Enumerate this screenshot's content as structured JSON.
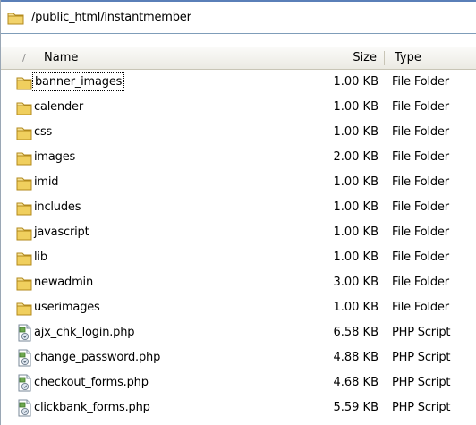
{
  "path": "/public_html/instantmember",
  "columns": {
    "sort_arrow": "/",
    "name": "Name",
    "size": "Size",
    "type": "Type"
  },
  "files": [
    {
      "name": "banner_images",
      "size": "1.00 KB",
      "type": "File Folder",
      "icon": "folder-icon"
    },
    {
      "name": "calender",
      "size": "1.00 KB",
      "type": "File Folder",
      "icon": "folder-icon"
    },
    {
      "name": "css",
      "size": "1.00 KB",
      "type": "File Folder",
      "icon": "folder-icon"
    },
    {
      "name": "images",
      "size": "2.00 KB",
      "type": "File Folder",
      "icon": "folder-icon"
    },
    {
      "name": "imid",
      "size": "1.00 KB",
      "type": "File Folder",
      "icon": "folder-icon"
    },
    {
      "name": "includes",
      "size": "1.00 KB",
      "type": "File Folder",
      "icon": "folder-icon"
    },
    {
      "name": "javascript",
      "size": "1.00 KB",
      "type": "File Folder",
      "icon": "folder-icon"
    },
    {
      "name": "lib",
      "size": "1.00 KB",
      "type": "File Folder",
      "icon": "folder-icon"
    },
    {
      "name": "newadmin",
      "size": "3.00 KB",
      "type": "File Folder",
      "icon": "folder-icon"
    },
    {
      "name": "userimages",
      "size": "1.00 KB",
      "type": "File Folder",
      "icon": "folder-icon"
    },
    {
      "name": "ajx_chk_login.php",
      "size": "6.58 KB",
      "type": "PHP Script",
      "icon": "php-file-icon"
    },
    {
      "name": "change_password.php",
      "size": "4.88 KB",
      "type": "PHP Script",
      "icon": "php-file-icon"
    },
    {
      "name": "checkout_forms.php",
      "size": "4.68 KB",
      "type": "PHP Script",
      "icon": "php-file-icon"
    },
    {
      "name": "clickbank_forms.php",
      "size": "5.59 KB",
      "type": "PHP Script",
      "icon": "php-file-icon"
    }
  ]
}
